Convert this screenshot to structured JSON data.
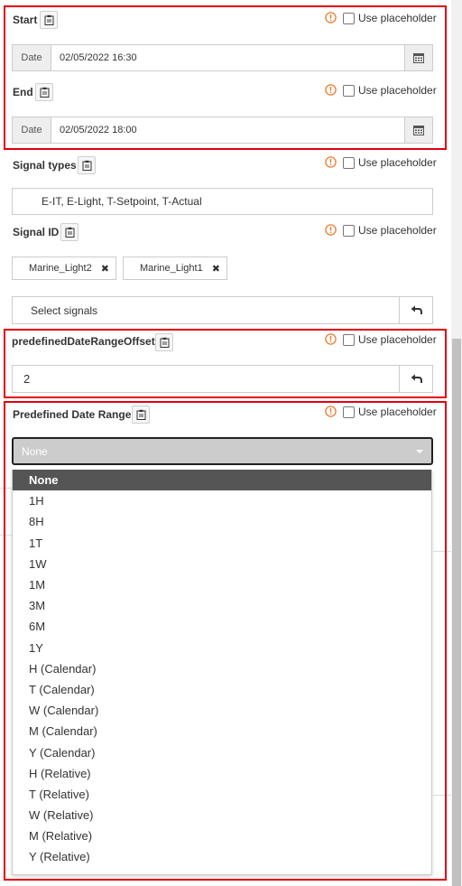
{
  "placeholder_label": "Use placeholder",
  "start": {
    "label": "Start",
    "addon": "Date",
    "value": "02/05/2022 16:30"
  },
  "end": {
    "label": "End",
    "addon": "Date",
    "value": "02/05/2022 18:00"
  },
  "signal_types": {
    "label": "Signal types",
    "value": "E-IT, E-Light, T-Setpoint, T-Actual"
  },
  "signal_id": {
    "label": "Signal ID",
    "chips": [
      "Marine_Light2",
      "Marine_Light1"
    ],
    "select_label": "Select signals"
  },
  "offset": {
    "label": "predefinedDateRangeOffset",
    "value": "2"
  },
  "date_range": {
    "label": "Predefined Date Range",
    "selected": "None",
    "options": [
      "None",
      "1H",
      "8H",
      "1T",
      "1W",
      "1M",
      "3M",
      "6M",
      "1Y",
      "H (Calendar)",
      "T (Calendar)",
      "W (Calendar)",
      "M (Calendar)",
      "Y (Calendar)",
      "H (Relative)",
      "T (Relative)",
      "W (Relative)",
      "M (Relative)",
      "Y (Relative)"
    ]
  },
  "colors": {
    "highlight_border": "#e3000f",
    "warning_icon": "#f07a2b",
    "selected_option_bg": "#555555"
  },
  "icons": {
    "clipboard": "clipboard-icon",
    "warning": "warning-circle-icon",
    "calendar": "calendar-icon",
    "undo": "undo-arrow-icon",
    "remove": "close-icon"
  }
}
